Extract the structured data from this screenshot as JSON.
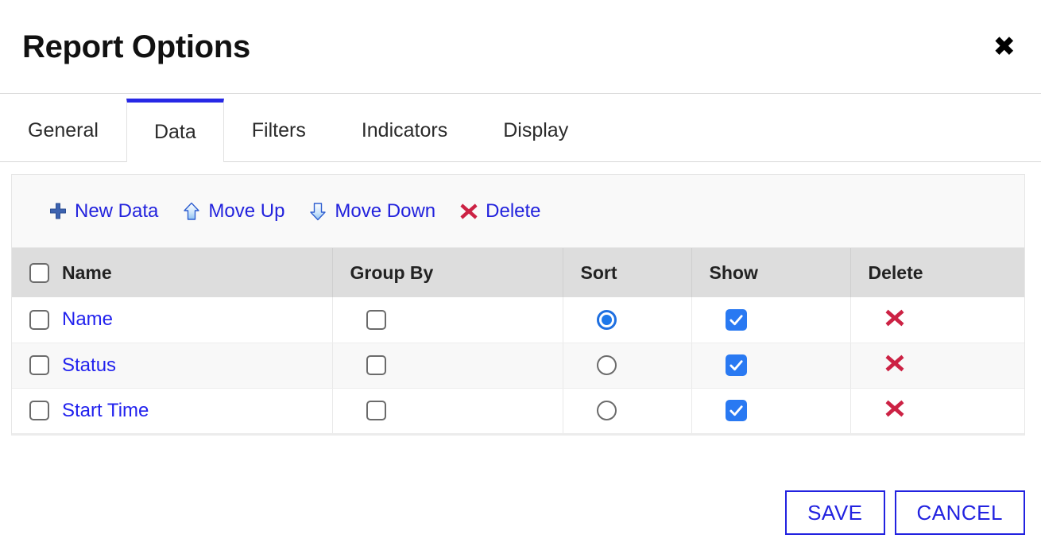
{
  "dialog": {
    "title": "Report Options",
    "close_icon": "close-icon",
    "close_glyph": "✖"
  },
  "tabs": [
    {
      "label": "General",
      "active": false
    },
    {
      "label": "Data",
      "active": true
    },
    {
      "label": "Filters",
      "active": false
    },
    {
      "label": "Indicators",
      "active": false
    },
    {
      "label": "Display",
      "active": false
    }
  ],
  "toolbar": [
    {
      "label": "New Data",
      "icon": "plus-icon"
    },
    {
      "label": "Move Up",
      "icon": "arrow-up-icon"
    },
    {
      "label": "Move Down",
      "icon": "arrow-down-icon"
    },
    {
      "label": "Delete",
      "icon": "delete-x-icon"
    }
  ],
  "table": {
    "columns": [
      {
        "key": "name",
        "label": "Name"
      },
      {
        "key": "group",
        "label": "Group By"
      },
      {
        "key": "sort",
        "label": "Sort"
      },
      {
        "key": "show",
        "label": "Show"
      },
      {
        "key": "delete",
        "label": "Delete"
      }
    ],
    "select_all_checked": false,
    "rows": [
      {
        "name": "Name",
        "selected": false,
        "group_by": false,
        "sort": true,
        "show": true,
        "delete_icon": "delete-x-icon"
      },
      {
        "name": "Status",
        "selected": false,
        "group_by": false,
        "sort": false,
        "show": true,
        "delete_icon": "delete-x-icon"
      },
      {
        "name": "Start Time",
        "selected": false,
        "group_by": false,
        "sort": false,
        "show": true,
        "delete_icon": "delete-x-icon"
      }
    ]
  },
  "footer": {
    "save_label": "SAVE",
    "cancel_label": "CANCEL"
  },
  "colors": {
    "accent_blue": "#2222e0",
    "tab_active_bar": "#2728e6",
    "link_blue": "#2222ee",
    "checkbox_blue": "#2979f2",
    "delete_red": "#cc2244",
    "header_gray": "#dddddd"
  }
}
